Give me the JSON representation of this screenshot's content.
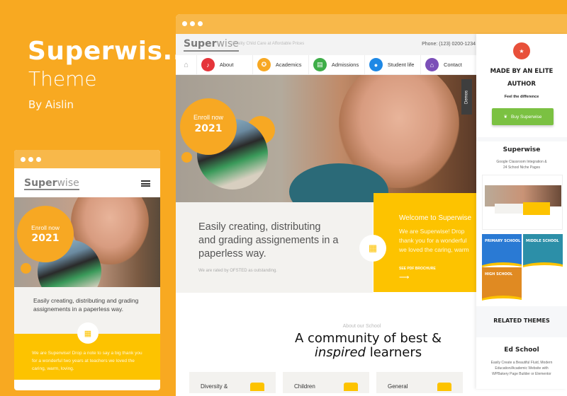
{
  "promo": {
    "title": "Superwis..",
    "subtitle": "Theme",
    "author": "By Aislin"
  },
  "desktop": {
    "logo_main": "Super",
    "logo_accent": "wise",
    "tagline": "Quality Child Care at Affordable Prices",
    "phone": "Phone: (123) 0200-1234",
    "nav": [
      {
        "label": "About",
        "icon": "bell-icon",
        "color": "#e5343a",
        "glyph": "🔔"
      },
      {
        "label": "Academics",
        "icon": "award-icon",
        "color": "#f7a823",
        "glyph": "✪"
      },
      {
        "label": "Admissions",
        "icon": "calendar-icon",
        "color": "#3fae49",
        "glyph": "▤"
      },
      {
        "label": "Student life",
        "icon": "user-icon",
        "color": "#1e88e5",
        "glyph": "●"
      },
      {
        "label": "Contact",
        "icon": "building-icon",
        "color": "#7b4fb8",
        "glyph": "⌂"
      }
    ],
    "enroll_label": "Enroll now",
    "enroll_year": "2021",
    "demos_label": "Demos",
    "feature_heading": "Easily creating, distributing and grading assignements in a paperless way.",
    "feature_note": "We are rated by OFSTED as outstanding.",
    "welcome_title": "Welcome to Superwise",
    "welcome_text_1": "We are Superwise! Drop",
    "welcome_text_2": "thank you for a wonderful",
    "welcome_text_3": "we loved the caring, warm",
    "brochure_link": "SEE PDF BROCHURE",
    "about_kicker": "About our School",
    "about_title_1": "A community of best &",
    "about_title_italic": "inspired",
    "about_title_2": " learners",
    "cards": [
      "Diversity &",
      "Children",
      "General"
    ]
  },
  "sidebar": {
    "elite_1": "MADE BY AN ELITE",
    "elite_2": "AUTHOR",
    "feel": "Feel the difference",
    "buy_label": "Buy Superwise",
    "product_name": "Superwise",
    "product_desc_1": "Google Classroom Integration &",
    "product_desc_2": "24 School Niche Pages",
    "tiles": [
      "PRIMARY SCHOOL",
      "MIDDLE SCHOOL",
      "HIGH SCHOOL"
    ],
    "related_heading": "RELATED THEMES",
    "related_name": "Ed School",
    "related_desc": "Easily Create a Beautiful Fluid, Modern Education/Academic Website with WPBakery Page Builder or Elementor"
  },
  "mobile": {
    "logo_main": "Super",
    "logo_accent": "wise",
    "enroll_label": "Enroll now",
    "enroll_year": "2021",
    "feature_heading": "Easily creating, distributing and grading assignements in a paperless way.",
    "welcome_text": "We are Superwise! Drop a note to say a big thank you for a wonderful two years at teachers we loved the caring, warm, loving."
  }
}
